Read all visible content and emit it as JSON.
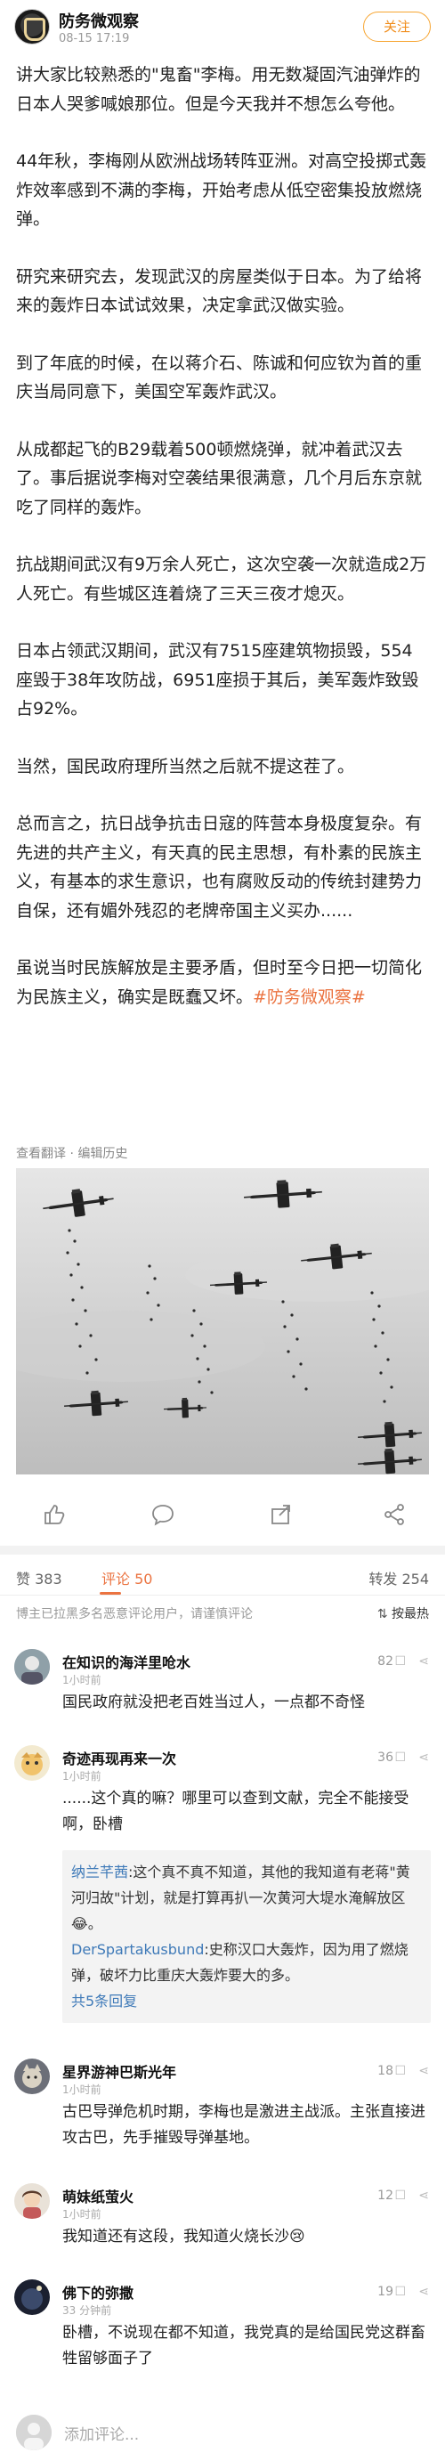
{
  "header": {
    "author_name": "防务微观察",
    "author_time": "08-15 17:19",
    "follow_label": "关注"
  },
  "post": {
    "paragraphs": [
      "讲大家比较熟悉的\"鬼畜\"李梅。用无数凝固汽油弹炸的日本人哭爹喊娘那位。但是今天我并不想怎么夸他。",
      "44年秋，李梅刚从欧洲战场转阵亚洲。对高空投掷式轰炸效率感到不满的李梅，开始考虑从低空密集投放燃烧弹。",
      "研究来研究去，发现武汉的房屋类似于日本。为了给将来的轰炸日本试试效果，决定拿武汉做实验。",
      "到了年底的时候，在以蒋介石、陈诚和何应钦为首的重庆当局同意下，美国空军轰炸武汉。",
      "从成都起飞的B29载着500顿燃烧弹，就冲着武汉去了。事后据说李梅对空袭结果很满意，几个月后东京就吃了同样的轰炸。",
      "抗战期间武汉有9万余人死亡，这次空袭一次就造成2万人死亡。有些城区连着烧了三天三夜才熄灭。",
      "日本占领武汉期间，武汉有7515座建筑物损毁，554座毁于38年攻防战，6951座损于其后，美军轰炸致毁占92%。",
      "当然，国民政府理所当然之后就不提这茬了。",
      "总而言之，抗日战争抗击日寇的阵营本身极度复杂。有先进的共产主义，有天真的民主思想，有朴素的民族主义，有基本的求生意识，也有腐败反动的传统封建势力自保，还有媚外残忍的老牌帝国主义买办......"
    ],
    "last_paragraph": "虽说当时民族解放是主要矛盾，但时至今日把一切简化为民族主义，确实是既蠢又坏。",
    "hashtag": "#防务微观察#",
    "translate_link": "查看翻译",
    "edit_history": "编辑历史",
    "meta_sep": " · "
  },
  "actions": {
    "icons": [
      "like-icon",
      "comment-icon",
      "repost-icon",
      "share-icon"
    ]
  },
  "stats": {
    "likes_label": "赞",
    "likes_count": "383",
    "comments_label": "评论",
    "comments_count": "50",
    "reposts_label": "转发",
    "reposts_count": "254"
  },
  "comments_header": {
    "notice": "博主已拉黑多名恶意评论用户，请谨慎评论",
    "sort_label": "按最热"
  },
  "comments": [
    {
      "name": "在知识的海洋里呛水",
      "time": "1小时前",
      "likes": "82",
      "text": "国民政府就没把老百姓当过人，一点都不奇怪"
    },
    {
      "name": "奇迹再现再来一次",
      "time": "1小时前",
      "likes": "36",
      "text": "......这个真的嘛？哪里可以查到文献，完全不能接受啊，卧槽",
      "replies": [
        {
          "name": "纳兰芊茜",
          "text": "这个真不真不知道，其他的我知道有老蒋\"黄河归故\"计划，就是打算再扒一次黄河大堤水淹解放区😂。"
        },
        {
          "name": "DerSpartakusbund",
          "text": "史称汉口大轰炸，因为用了燃烧弹，破坏力比重庆大轰炸要大的多。"
        }
      ],
      "more_replies": "共5条回复"
    },
    {
      "name": "星界游神巴斯光年",
      "time": "1小时前",
      "likes": "18",
      "text": "古巴导弹危机时期，李梅也是激进主战派。主张直接进攻古巴，先手摧毁导弹基地。"
    },
    {
      "name": "萌妹纸萤火",
      "time": "1小时前",
      "likes": "12",
      "text": "我知道还有这段，我知道火烧长沙😢"
    },
    {
      "name": "佛下的弥撒",
      "time": "33 分钟前",
      "likes": "19",
      "text": "卧槽，不说现在都不知道，我党真的是给国民党这群畜牲留够面子了"
    }
  ],
  "bottom": {
    "placeholder": "添加评论..."
  }
}
